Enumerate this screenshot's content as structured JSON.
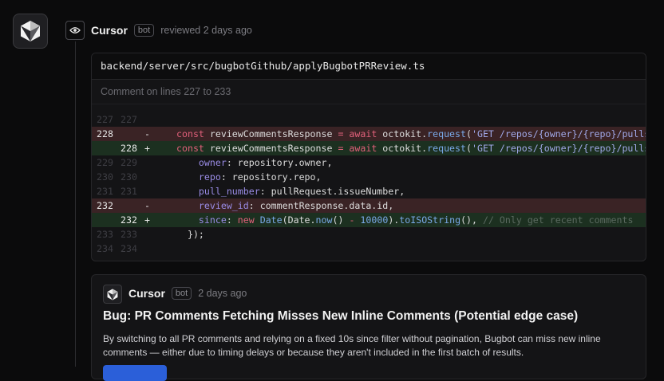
{
  "review": {
    "author": "Cursor",
    "badge": "bot",
    "meta": "reviewed 2 days ago"
  },
  "file": {
    "path": "backend/server/src/bugbotGithub/applyBugbotPRReview.ts",
    "comment_range": "Comment on lines 227 to 233"
  },
  "diff": [
    {
      "type": "ctx",
      "old": "227",
      "new": "227",
      "sign": "",
      "tokens": []
    },
    {
      "type": "del",
      "old": "228",
      "new": "",
      "sign": "-",
      "tokens": [
        {
          "c": "kw",
          "t": "const "
        },
        {
          "c": "plain",
          "t": "reviewCommentsResponse "
        },
        {
          "c": "kw",
          "t": "= await "
        },
        {
          "c": "plain",
          "t": "octokit."
        },
        {
          "c": "fn",
          "t": "request"
        },
        {
          "c": "plain",
          "t": "("
        },
        {
          "c": "str",
          "t": "'GET /repos/{owner}/{repo}/pulls/{pull_number}/reviews'"
        }
      ]
    },
    {
      "type": "add",
      "old": "",
      "new": "228",
      "sign": "+",
      "tokens": [
        {
          "c": "kw",
          "t": "const "
        },
        {
          "c": "plain",
          "t": "reviewCommentsResponse "
        },
        {
          "c": "kw",
          "t": "= await "
        },
        {
          "c": "plain",
          "t": "octokit."
        },
        {
          "c": "fn",
          "t": "request"
        },
        {
          "c": "plain",
          "t": "("
        },
        {
          "c": "str",
          "t": "'GET /repos/{owner}/{repo}/pulls/{pull_number}/comments'"
        }
      ]
    },
    {
      "type": "ctx",
      "old": "229",
      "new": "229",
      "sign": "",
      "tokens": [
        {
          "c": "plain",
          "t": "    "
        },
        {
          "c": "prop",
          "t": "owner"
        },
        {
          "c": "plain",
          "t": ": repository.owner,"
        }
      ]
    },
    {
      "type": "ctx",
      "old": "230",
      "new": "230",
      "sign": "",
      "tokens": [
        {
          "c": "plain",
          "t": "    "
        },
        {
          "c": "prop",
          "t": "repo"
        },
        {
          "c": "plain",
          "t": ": repository.repo,"
        }
      ]
    },
    {
      "type": "ctx",
      "old": "231",
      "new": "231",
      "sign": "",
      "tokens": [
        {
          "c": "plain",
          "t": "    "
        },
        {
          "c": "prop",
          "t": "pull_number"
        },
        {
          "c": "plain",
          "t": ": pullRequest.issueNumber,"
        }
      ]
    },
    {
      "type": "del",
      "old": "232",
      "new": "",
      "sign": "-",
      "tokens": [
        {
          "c": "plain",
          "t": "    "
        },
        {
          "c": "prop",
          "t": "review_id"
        },
        {
          "c": "plain",
          "t": ": commentResponse.data.id,"
        }
      ]
    },
    {
      "type": "add",
      "old": "",
      "new": "232",
      "sign": "+",
      "tokens": [
        {
          "c": "plain",
          "t": "    "
        },
        {
          "c": "prop",
          "t": "since"
        },
        {
          "c": "plain",
          "t": ": "
        },
        {
          "c": "kw",
          "t": "new "
        },
        {
          "c": "fn",
          "t": "Date"
        },
        {
          "c": "plain",
          "t": "(Date."
        },
        {
          "c": "fn",
          "t": "now"
        },
        {
          "c": "plain",
          "t": "() "
        },
        {
          "c": "kw",
          "t": "- "
        },
        {
          "c": "num",
          "t": "10000"
        },
        {
          "c": "plain",
          "t": ")."
        },
        {
          "c": "fn",
          "t": "toISOString"
        },
        {
          "c": "plain",
          "t": "(), "
        },
        {
          "c": "cmt",
          "t": "// Only get recent comments"
        }
      ]
    },
    {
      "type": "ctx",
      "old": "233",
      "new": "233",
      "sign": "",
      "tokens": [
        {
          "c": "plain",
          "t": "  });"
        }
      ]
    },
    {
      "type": "ctx",
      "old": "234",
      "new": "234",
      "sign": "",
      "tokens": []
    }
  ],
  "comment": {
    "author": "Cursor",
    "badge": "bot",
    "meta": "2 days ago",
    "title": "Bug: PR Comments Fetching Misses New Inline Comments (Potential edge case)",
    "body": "By switching to all PR comments and relying on a fixed 10s since filter without pagination, Bugbot can miss new inline comments — either due to timing delays or because they aren't included in the first batch of results."
  },
  "icons": {
    "avatar": "cursor-cube-logo-icon",
    "visibility": "eye-icon"
  },
  "colors": {
    "deleted_line_bg": "#3a2325",
    "added_line_bg": "#1c3020",
    "primary_button": "#2b5fd9"
  }
}
